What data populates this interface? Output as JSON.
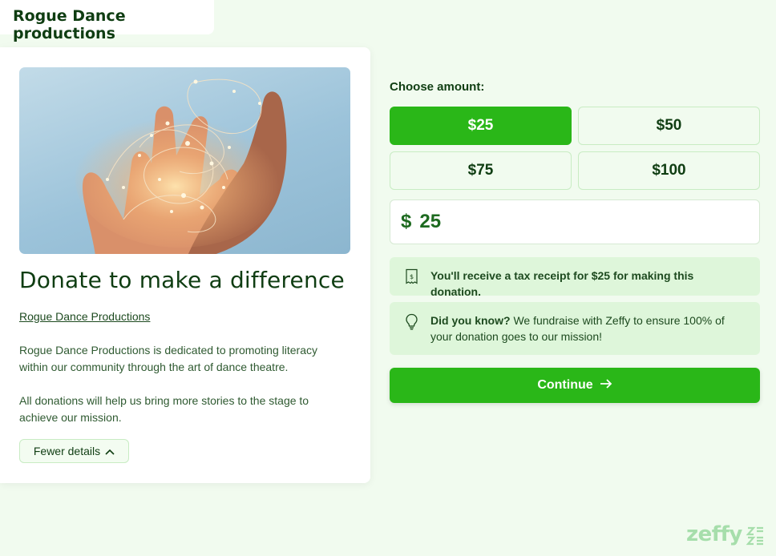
{
  "org_name": "Rogue Dance productions",
  "card": {
    "title": "Donate to make a difference",
    "org_link": "Rogue Dance Productions",
    "description_1": "Rogue Dance Productions is dedicated to promoting literacy within our community through the art of dance theatre.",
    "description_2": "All donations will help us bring more stories to the stage to achieve our mission.",
    "fewer_details_label": "Fewer details"
  },
  "donation": {
    "choose_label": "Choose amount:",
    "amounts": [
      "$25",
      "$50",
      "$75",
      "$100"
    ],
    "selected_amount": "$25",
    "currency_symbol": "$",
    "amount_value": "25",
    "tax_receipt_text": "You'll receive a tax receipt for $25 for making this donation.",
    "did_you_know_label": "Did you know?",
    "did_you_know_text": " We fundraise with Zeffy to ensure 100% of your donation goes to our mission!",
    "continue_label": "Continue"
  },
  "footer": {
    "logo_text": "zeffy"
  },
  "icons": {
    "receipt": "receipt-icon",
    "lightbulb": "lightbulb-icon",
    "arrow": "arrow-right-icon",
    "chevron": "chevron-up-icon"
  },
  "colors": {
    "accent": "#2ab718",
    "background": "#f1fbef",
    "info_bg": "#def6da",
    "text_dark": "#0f3d12"
  }
}
